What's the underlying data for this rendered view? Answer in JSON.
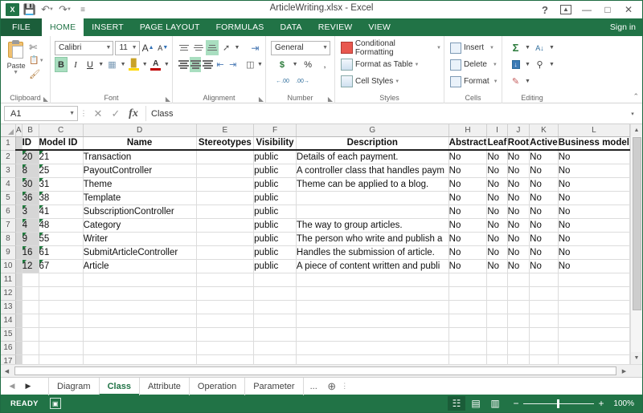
{
  "window": {
    "title": "ArticleWriting.xlsx - Excel",
    "quick_access": [
      {
        "name": "excel-logo",
        "glyph": "X"
      },
      {
        "name": "save-icon",
        "glyph": "὚B"
      },
      {
        "name": "undo-icon",
        "glyph": "↶"
      },
      {
        "name": "redo-icon",
        "glyph": "↷"
      },
      {
        "name": "customize-qat-icon",
        "glyph": "≡"
      }
    ],
    "controls": {
      "help": "?",
      "ribbon_display": "▣",
      "minimize": "—",
      "maximize": "□",
      "close": "✕"
    }
  },
  "ribbon": {
    "tabs": [
      {
        "label": "FILE",
        "active": false,
        "file": true
      },
      {
        "label": "HOME",
        "active": true
      },
      {
        "label": "INSERT",
        "active": false
      },
      {
        "label": "PAGE LAYOUT",
        "active": false
      },
      {
        "label": "FORMULAS",
        "active": false
      },
      {
        "label": "DATA",
        "active": false
      },
      {
        "label": "REVIEW",
        "active": false
      },
      {
        "label": "VIEW",
        "active": false
      }
    ],
    "sign_in": "Sign in",
    "collapse_glyph": "⌃",
    "groups": {
      "clipboard": {
        "label": "Clipboard",
        "paste": "Paste",
        "cut": "✂",
        "copy": "❐",
        "format_painter": "✎"
      },
      "font": {
        "label": "Font",
        "font_name": "Calibri",
        "font_size": "11",
        "grow": "A",
        "shrink": "A",
        "bold": "B",
        "italic": "I",
        "underline": "U",
        "borders": "⊞",
        "fill_color": "A",
        "font_color": "A"
      },
      "alignment": {
        "label": "Alignment",
        "orientation": "↗",
        "wrap_text": "↵",
        "merge_center": "↔",
        "decrease_indent": "⇤",
        "increase_indent": "⇥"
      },
      "number": {
        "label": "Number",
        "format": "General",
        "currency": "$",
        "percent": "%",
        "comma": ",",
        "increase_decimal": ".00",
        "decrease_decimal": ".0"
      },
      "styles": {
        "label": "Styles",
        "items": [
          {
            "label": "Conditional Formatting",
            "icon": "conditional-formatting-icon"
          },
          {
            "label": "Format as Table",
            "icon": "format-as-table-icon"
          },
          {
            "label": "Cell Styles",
            "icon": "cell-styles-icon"
          }
        ]
      },
      "cells": {
        "label": "Cells",
        "items": [
          {
            "label": "Insert",
            "icon": "insert-cells-icon"
          },
          {
            "label": "Delete",
            "icon": "delete-cells-icon"
          },
          {
            "label": "Format",
            "icon": "format-cells-icon"
          }
        ]
      },
      "editing": {
        "label": "Editing",
        "autosum": "Σ",
        "sort_filter": "A↓",
        "fill": "↓",
        "find_select": "⚲",
        "clear": "⌫"
      }
    }
  },
  "formula_bar": {
    "name_box": "A1",
    "cancel": "✕",
    "enter": "✓",
    "insert_function": "fx",
    "value": "Class",
    "expand": "▾"
  },
  "sheet": {
    "columns": [
      "A",
      "B",
      "C",
      "D",
      "E",
      "F",
      "G",
      "H",
      "I",
      "J",
      "K",
      "L"
    ],
    "header_row_number": "1",
    "headers": [
      "",
      "ID",
      "Model ID",
      "Name",
      "Stereotypes",
      "Visibility",
      "Description",
      "Abstract",
      "Leaf",
      "Root",
      "Active",
      "Business model"
    ],
    "rows": [
      {
        "n": "2",
        "cells": [
          "",
          "20",
          "21",
          "Transaction",
          "",
          "public",
          "Details of each payment.",
          "No",
          "No",
          "No",
          "No",
          "No"
        ]
      },
      {
        "n": "3",
        "cells": [
          "",
          "8",
          "25",
          "PayoutController",
          "",
          "public",
          "A controller class that handles paym",
          "No",
          "No",
          "No",
          "No",
          "No"
        ]
      },
      {
        "n": "4",
        "cells": [
          "",
          "30",
          "31",
          "Theme",
          "",
          "public",
          "Theme can be applied to a blog.",
          "No",
          "No",
          "No",
          "No",
          "No"
        ]
      },
      {
        "n": "5",
        "cells": [
          "",
          "36",
          "38",
          "Template",
          "",
          "public",
          "",
          "No",
          "No",
          "No",
          "No",
          "No"
        ]
      },
      {
        "n": "6",
        "cells": [
          "",
          "3",
          "41",
          "SubscriptionController",
          "",
          "public",
          "",
          "No",
          "No",
          "No",
          "No",
          "No"
        ]
      },
      {
        "n": "7",
        "cells": [
          "",
          "4",
          "48",
          "Category",
          "",
          "public",
          "The way to group articles.",
          "No",
          "No",
          "No",
          "No",
          "No"
        ]
      },
      {
        "n": "8",
        "cells": [
          "",
          "9",
          "55",
          "Writer",
          "",
          "public",
          "The person who write and publish a",
          "No",
          "No",
          "No",
          "No",
          "No"
        ]
      },
      {
        "n": "9",
        "cells": [
          "",
          "16",
          "61",
          "SubmitArticleController",
          "",
          "public",
          "Handles the submission of article.",
          "No",
          "No",
          "No",
          "No",
          "No"
        ]
      },
      {
        "n": "10",
        "cells": [
          "",
          "12",
          "67",
          "Article",
          "",
          "public",
          "A piece of content written and publi",
          "No",
          "No",
          "No",
          "No",
          "No"
        ]
      },
      {
        "n": "11",
        "cells": [
          "",
          "",
          "",
          "",
          "",
          "",
          "",
          "",
          "",
          "",
          "",
          ""
        ]
      },
      {
        "n": "12",
        "cells": [
          "",
          "",
          "",
          "",
          "",
          "",
          "",
          "",
          "",
          "",
          "",
          ""
        ]
      },
      {
        "n": "13",
        "cells": [
          "",
          "",
          "",
          "",
          "",
          "",
          "",
          "",
          "",
          "",
          "",
          ""
        ]
      },
      {
        "n": "14",
        "cells": [
          "",
          "",
          "",
          "",
          "",
          "",
          "",
          "",
          "",
          "",
          "",
          ""
        ]
      },
      {
        "n": "15",
        "cells": [
          "",
          "",
          "",
          "",
          "",
          "",
          "",
          "",
          "",
          "",
          "",
          ""
        ]
      },
      {
        "n": "16",
        "cells": [
          "",
          "",
          "",
          "",
          "",
          "",
          "",
          "",
          "",
          "",
          "",
          ""
        ]
      },
      {
        "n": "17",
        "cells": [
          "",
          "",
          "",
          "",
          "",
          "",
          "",
          "",
          "",
          "",
          "",
          ""
        ]
      }
    ]
  },
  "sheet_tabs": {
    "first_glyph": "◀",
    "prev_glyph": "▶",
    "tabs": [
      {
        "label": "Diagram",
        "active": false
      },
      {
        "label": "Class",
        "active": true
      },
      {
        "label": "Attribute",
        "active": false
      },
      {
        "label": "Operation",
        "active": false
      },
      {
        "label": "Parameter",
        "active": false
      }
    ],
    "overflow": "...",
    "add_sheet": "⊕"
  },
  "status_bar": {
    "state": "READY",
    "macro_icon": "macro-record-icon",
    "views": [
      {
        "name": "normal-view",
        "glyph": "☷",
        "active": true
      },
      {
        "name": "page-layout-view",
        "glyph": "▤",
        "active": false
      },
      {
        "name": "page-break-view",
        "glyph": "▥",
        "active": false
      }
    ],
    "zoom_out": "−",
    "zoom_in": "+",
    "zoom_level": "100%"
  },
  "colors": {
    "excel_green": "#217346",
    "excel_dark_green": "#1b5e3a",
    "highlight_green": "#a9dec0",
    "error_triangle": "#1f7a3d"
  }
}
